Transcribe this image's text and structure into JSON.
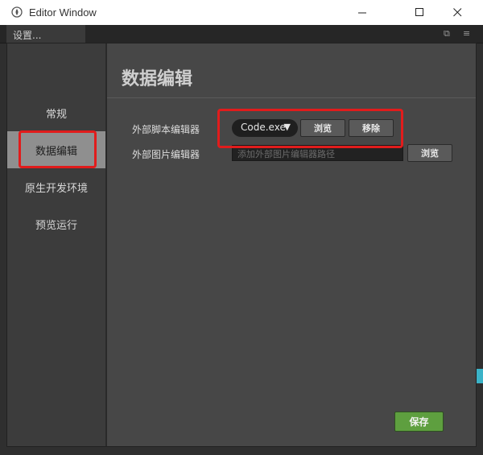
{
  "window": {
    "title": "Editor Window"
  },
  "background": {
    "tab_label": "设置..."
  },
  "sidebar": {
    "items": [
      {
        "label": "常规"
      },
      {
        "label": "数据编辑",
        "active": true
      },
      {
        "label": "原生开发环境"
      },
      {
        "label": "预览运行"
      }
    ]
  },
  "main": {
    "title": "数据编辑",
    "script_editor": {
      "label": "外部脚本编辑器",
      "selected": "Code.exe",
      "browse_label": "浏览",
      "remove_label": "移除"
    },
    "image_editor": {
      "label": "外部图片编辑器",
      "placeholder": "添加外部图片编辑器路径",
      "browse_label": "浏览"
    },
    "save_label": "保存"
  },
  "colors": {
    "accent_save": "#5e9f3f",
    "highlight": "#e11c1c",
    "sidebar_active": "#8f8f8f"
  }
}
